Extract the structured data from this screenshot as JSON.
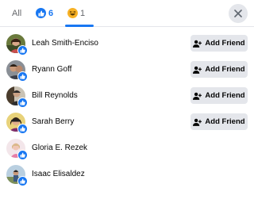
{
  "tabs": {
    "all_label": "All",
    "like_count": "6",
    "haha_count": "1"
  },
  "colors": {
    "accent": "#1877f2",
    "button_bg": "#e4e6eb",
    "haha": "#f7b125"
  },
  "icons": [
    "like-icon",
    "haha-icon",
    "close-icon",
    "add-friend-icon"
  ],
  "people": [
    {
      "name": "Leah Smith-Enciso",
      "action": "Add Friend"
    },
    {
      "name": "Ryann Goff",
      "action": "Add Friend"
    },
    {
      "name": "Bill Reynolds",
      "action": "Add Friend"
    },
    {
      "name": "Sarah Berry",
      "action": "Add Friend"
    },
    {
      "name": "Gloria E. Rezek"
    },
    {
      "name": "Isaac Elisaldez"
    }
  ]
}
